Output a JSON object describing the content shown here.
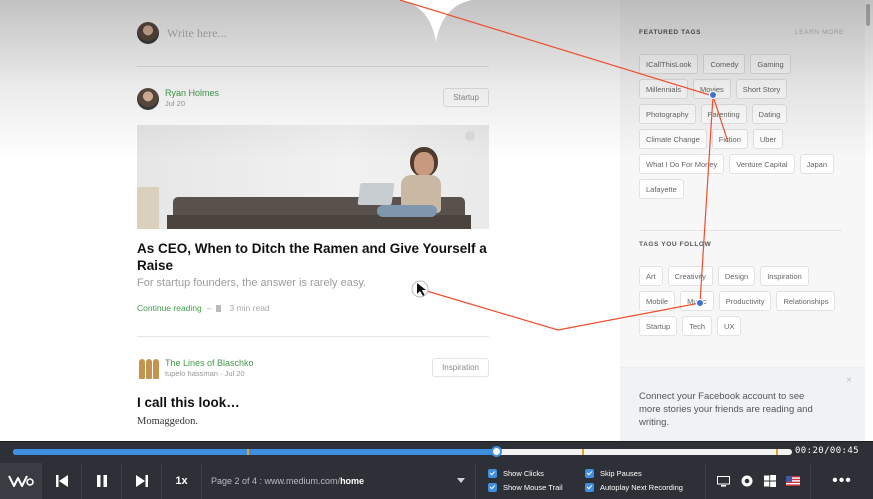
{
  "compose": {
    "placeholder": "Write here..."
  },
  "articles": [
    {
      "author": "Ryan Holmes",
      "meta": "Jul 20",
      "topic": "Startup",
      "title": "As CEO, When to Ditch the Ramen and Give Yourself a Raise",
      "subtitle": "For startup founders, the answer is rarely easy.",
      "continue_label": "Continue reading",
      "separator": "–",
      "read_time": "3 min read"
    },
    {
      "author": "The Lines of Blaschko",
      "meta": "tupelo hassman · Jul 20",
      "topic": "Inspiration",
      "title": "I call this look…",
      "subtitle": "Momaggedon."
    }
  ],
  "sidebar": {
    "featured_heading": "FEATURED TAGS",
    "learn_more": "LEARN MORE",
    "featured_tags": [
      "ICallThisLook",
      "Comedy",
      "Gaming",
      "Millennials",
      "Movies",
      "Short Story",
      "Photography",
      "Parenting",
      "Dating",
      "Climate Change",
      "Fiction",
      "Uber",
      "What I Do For Money",
      "Venture Capital",
      "Japan",
      "Lafayette"
    ],
    "follow_heading": "TAGS YOU FOLLOW",
    "follow_tags": [
      "Art",
      "Creativity",
      "Design",
      "Inspiration",
      "Mobile",
      "Music",
      "Productivity",
      "Relationships",
      "Startup",
      "Tech",
      "UX"
    ],
    "facebook_prompt": "Connect your Facebook account to see more stories your friends are reading and writing.",
    "close_glyph": "×"
  },
  "player": {
    "logo": "W",
    "speed": "1x",
    "page_prefix": "Page 2 of 4 : www.medium.com/",
    "page_path": "home",
    "time": "00:20/00:45",
    "progress": 0.62,
    "markers": [
      0.3,
      0.73,
      0.98
    ],
    "options": {
      "show_clicks": "Show Clicks",
      "show_mouse_trail": "Show Mouse Trail",
      "skip_pauses": "Skip Pauses",
      "autoplay_next": "Autoplay Next Recording"
    },
    "more": "•••"
  },
  "colors": {
    "accent": "#3f8fe0",
    "trail": "#ef4d2d",
    "medium_green": "#3f9c49",
    "marker": "#e2a623"
  },
  "icons": [
    "prev-icon",
    "pause-icon",
    "next-icon",
    "desktop-icon",
    "chrome-icon",
    "windows-icon",
    "us-flag-icon",
    "cursor-icon",
    "bookmark-icon"
  ]
}
